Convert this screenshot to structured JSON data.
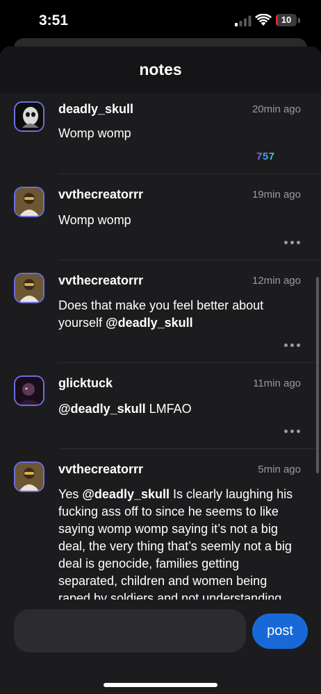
{
  "status_bar": {
    "time": "3:51",
    "battery_level": "10",
    "battery_fraction": 0.1,
    "signal_bars_active": 1,
    "signal_bars_total": 4
  },
  "sheet": {
    "title": "notes"
  },
  "notes": [
    {
      "username": "deadly_skull",
      "time": "20min ago",
      "body": [
        {
          "text": "Womp womp",
          "mention": false
        }
      ],
      "count": "757",
      "avatar": "skull-avatar-icon"
    },
    {
      "username": "vvthecreatorrr",
      "time": "19min ago",
      "body": [
        {
          "text": "Womp womp",
          "mention": false
        }
      ],
      "avatar": "person-avatar-icon"
    },
    {
      "username": "vvthecreatorrr",
      "time": "12min ago",
      "body": [
        {
          "text": "Does that make you feel better about yourself ",
          "mention": false
        },
        {
          "text": "@deadly_skull",
          "mention": true
        }
      ],
      "avatar": "person-avatar-icon"
    },
    {
      "username": "glicktuck",
      "time": "11min ago",
      "body": [
        {
          "text": "@deadly_skull",
          "mention": true
        },
        {
          "text": " LMFAO",
          "mention": false
        }
      ],
      "avatar": "dark-avatar-icon"
    },
    {
      "username": "vvthecreatorrr",
      "time": "5min ago",
      "body": [
        {
          "text": "Yes ",
          "mention": false
        },
        {
          "text": "@deadly_skull",
          "mention": true
        },
        {
          "text": " Is clearly laughing his fucking ass off to since he seems to like saying womp womp saying it’s not a big deal, the very thing that’s seemly not a big deal is genocide, families getting separated, children and women being raped by soldiers and not understanding",
          "mention": false
        }
      ],
      "avatar": "person-avatar-icon"
    }
  ],
  "composer": {
    "value": "",
    "placeholder": ""
  },
  "post_button": {
    "label": "post",
    "color": "#1769d8"
  },
  "colors": {
    "sheet_bg": "#1c1c1e",
    "header_bg": "#151517",
    "avatar_border": "#6e6ee0",
    "muted_text": "#9a9aa0",
    "battery_red": "#e5262b"
  }
}
